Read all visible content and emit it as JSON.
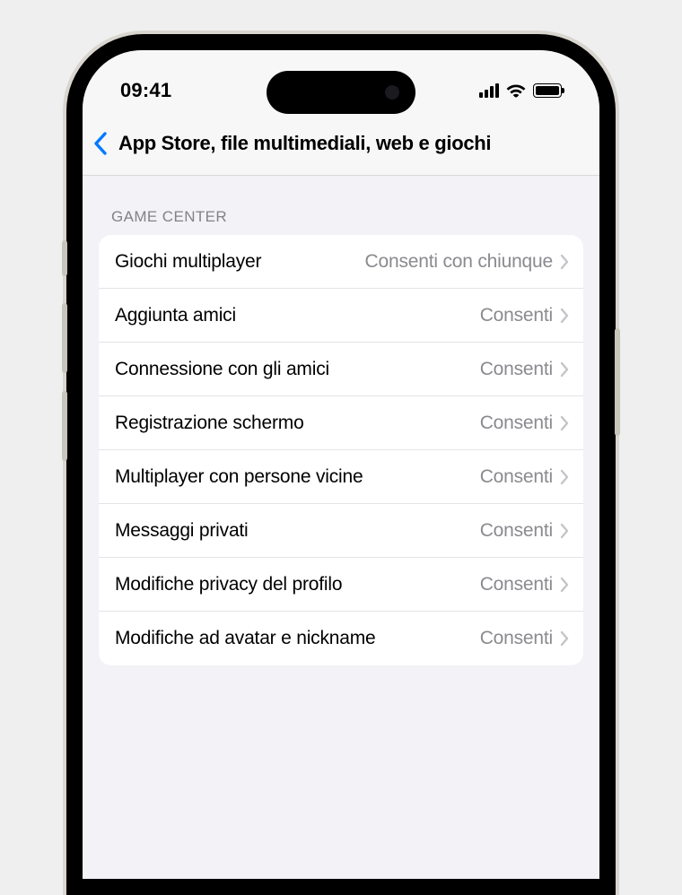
{
  "status_bar": {
    "time": "09:41"
  },
  "nav": {
    "title": "App Store, file multimediali, web e giochi"
  },
  "section": {
    "header": "GAME CENTER",
    "rows": [
      {
        "label": "Giochi multiplayer",
        "value": "Consenti con chiunque"
      },
      {
        "label": "Aggiunta amici",
        "value": "Consenti"
      },
      {
        "label": "Connessione con gli amici",
        "value": "Consenti"
      },
      {
        "label": "Registrazione schermo",
        "value": "Consenti"
      },
      {
        "label": "Multiplayer con persone vicine",
        "value": "Consenti"
      },
      {
        "label": "Messaggi privati",
        "value": "Consenti"
      },
      {
        "label": "Modifiche privacy del profilo",
        "value": "Consenti"
      },
      {
        "label": "Modifiche ad avatar e nickname",
        "value": "Consenti"
      }
    ]
  }
}
